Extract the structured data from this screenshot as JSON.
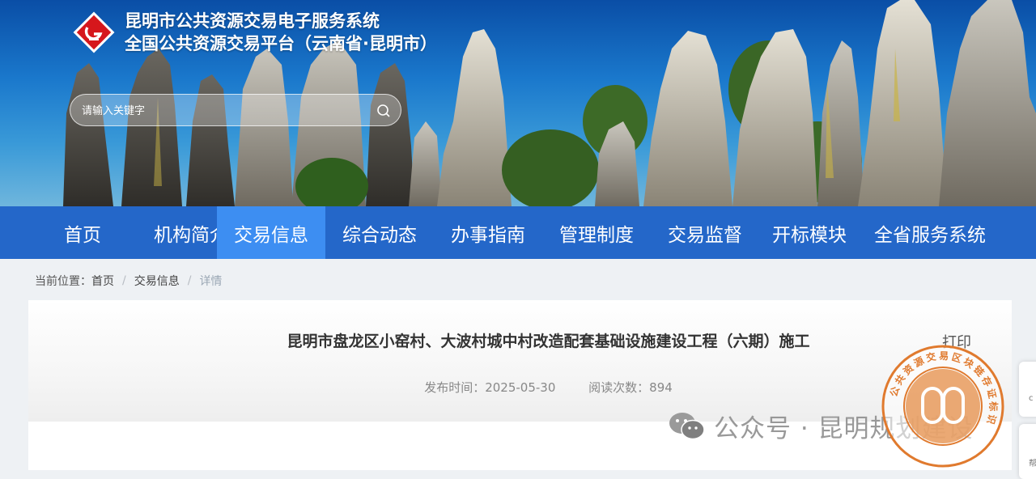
{
  "header": {
    "title_line1": "昆明市公共资源交易电子服务系统",
    "title_line2": "全国公共资源交易平台（云南省·昆明市）",
    "logo_icon": "diamond-logo-icon"
  },
  "search": {
    "placeholder": "请输入关键字",
    "icon": "search-icon"
  },
  "nav": {
    "items": [
      {
        "label": "首页"
      },
      {
        "label": "机构简介"
      },
      {
        "label": "交易信息"
      },
      {
        "label": "综合动态"
      },
      {
        "label": "办事指南"
      },
      {
        "label": "管理制度"
      },
      {
        "label": "交易监督"
      },
      {
        "label": "开标模块"
      },
      {
        "label": "全省服务系统"
      }
    ],
    "active_index": 2
  },
  "breadcrumb": {
    "prefix": "当前位置：",
    "items": [
      "首页",
      "交易信息",
      "详情"
    ],
    "separator": "/"
  },
  "article": {
    "title": "昆明市盘龙区小窑村、大波村城中村改造配套基础设施建设工程（六期）施工",
    "published_label": "发布时间：2025-05-30",
    "views_label": "阅读次数：894",
    "print_label": "打印"
  },
  "watermark": {
    "text": "公众号 · 昆明规划建设",
    "icon": "wechat-icon"
  },
  "seal": {
    "ring_text": "公共资源交易区块链存证标识"
  },
  "side_tabs": [
    {
      "text": "c"
    },
    {
      "text": "帮"
    }
  ],
  "colors": {
    "nav_bg": "#2467c9",
    "nav_active": "#3d8ef2",
    "seal": "#e07a2e",
    "logo_red": "#d6171c"
  }
}
